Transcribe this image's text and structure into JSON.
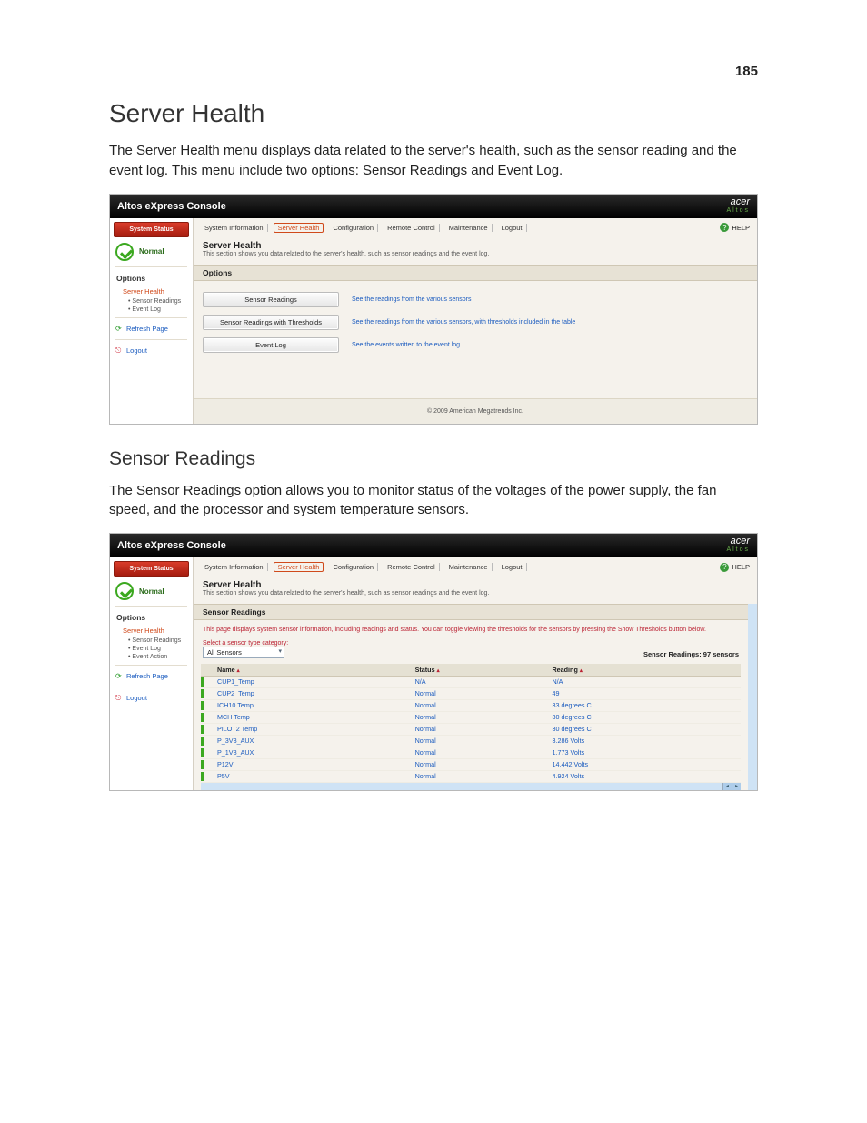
{
  "page_number": "185",
  "doc": {
    "h1": "Server Health",
    "p1": "The Server Health menu displays data related to the server's health, such as the sensor reading and the event log. This menu include two options: Sensor Readings and Event Log.",
    "h2": "Sensor Readings",
    "p2": "The Sensor Readings option allows you to monitor status of the voltages of the power supply, the fan speed, and the processor and system temperature sensors."
  },
  "console": {
    "title": "Altos eXpress Console",
    "brand_acer": "acer",
    "brand_altos": "Altos",
    "help": "HELP",
    "side": {
      "badge": "System Status",
      "status": "Normal",
      "options": "Options",
      "server_health": "Server Health",
      "sensor_readings": "Sensor Readings",
      "event_log": "Event Log",
      "event_action": "Event Action",
      "refresh": "Refresh Page",
      "logout": "Logout"
    },
    "tabs": [
      "System Information",
      "Server Health",
      "Configuration",
      "Remote Control",
      "Maintenance",
      "Logout"
    ],
    "section": {
      "title": "Server Health",
      "desc": "This section shows you data related to the server's health, such as sensor readings and the event log."
    },
    "panel_options": "Options",
    "opts": [
      {
        "btn": "Sensor Readings",
        "desc": "See the readings from the various sensors"
      },
      {
        "btn": "Sensor Readings with Thresholds",
        "desc": "See the readings from the various sensors, with thresholds included in the table"
      },
      {
        "btn": "Event Log",
        "desc": "See the events written to the event log"
      }
    ],
    "footer": "© 2009 American Megatrends Inc."
  },
  "sensor": {
    "panel": "Sensor Readings",
    "desc": "This page displays system sensor information, including readings and status. You can toggle viewing the thresholds for the sensors by pressing the Show Thresholds button below.",
    "select_label": "Select a sensor type category:",
    "select_value": "All Sensors",
    "count": "Sensor Readings: 97 sensors",
    "cols": {
      "name": "Name",
      "status": "Status",
      "reading": "Reading"
    },
    "rows": [
      {
        "name": "CUP1_Temp",
        "status": "N/A",
        "reading": "N/A"
      },
      {
        "name": "CUP2_Temp",
        "status": "Normal",
        "reading": "49"
      },
      {
        "name": "ICH10 Temp",
        "status": "Normal",
        "reading": "33 degrees C"
      },
      {
        "name": "MCH Temp",
        "status": "Normal",
        "reading": "30 degrees C"
      },
      {
        "name": "PILOT2 Temp",
        "status": "Normal",
        "reading": "30 degrees C"
      },
      {
        "name": "P_3V3_AUX",
        "status": "Normal",
        "reading": "3.286 Volts"
      },
      {
        "name": "P_1V8_AUX",
        "status": "Normal",
        "reading": "1.773 Volts"
      },
      {
        "name": "P12V",
        "status": "Normal",
        "reading": "14.442 Volts"
      },
      {
        "name": "P5V",
        "status": "Normal",
        "reading": "4.924 Volts"
      }
    ]
  }
}
